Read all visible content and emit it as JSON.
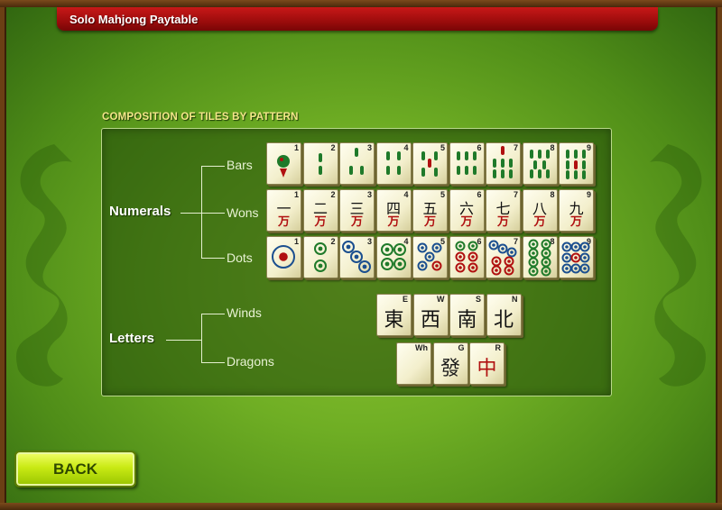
{
  "window": {
    "title": "Solo Mahjong Paytable"
  },
  "section": {
    "title": "COMPOSITION OF TILES BY PATTERN"
  },
  "categories": {
    "numerals": "Numerals",
    "letters": "Letters"
  },
  "suits": {
    "bars": "Bars",
    "wons": "Wons",
    "dots": "Dots",
    "winds": "Winds",
    "dragons": "Dragons"
  },
  "tiles": {
    "bars": [
      "1",
      "2",
      "3",
      "4",
      "5",
      "6",
      "7",
      "8",
      "9"
    ],
    "wons": {
      "numbers": [
        "1",
        "2",
        "3",
        "4",
        "5",
        "6",
        "7",
        "8",
        "9"
      ],
      "characters": [
        "一",
        "二",
        "三",
        "四",
        "五",
        "六",
        "七",
        "八",
        "九"
      ],
      "wan": "万"
    },
    "dots": [
      "1",
      "2",
      "3",
      "4",
      "5",
      "6",
      "7",
      "8",
      "9"
    ],
    "winds": [
      {
        "label": "E",
        "char": "東"
      },
      {
        "label": "W",
        "char": "西"
      },
      {
        "label": "S",
        "char": "南"
      },
      {
        "label": "N",
        "char": "北"
      }
    ],
    "dragons": [
      {
        "label": "Wh",
        "char": ""
      },
      {
        "label": "G",
        "char": "發"
      },
      {
        "label": "R",
        "char": "中"
      }
    ]
  },
  "colors": {
    "accent_red": "#b01010",
    "bar_green": "#1f7a2a",
    "dot_blue": "#1b4f8f",
    "button_text": "#2f4800"
  },
  "footer": {
    "back_label": "BACK"
  }
}
